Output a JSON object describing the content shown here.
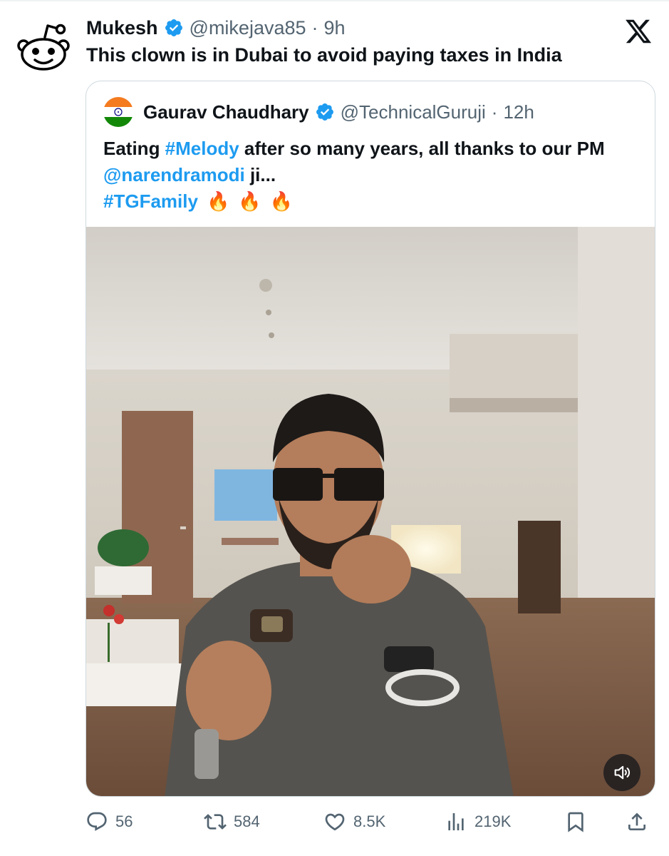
{
  "tweet": {
    "author_name": "Mukesh",
    "author_handle": "@mikejava85",
    "separator": "·",
    "time": "9h",
    "text": "This clown is in Dubai to avoid paying taxes in India",
    "avatar_icon": "reddit-snoo-icon",
    "platform_icon": "x-logo-icon"
  },
  "quoted": {
    "author_name": "Gaurav Chaudhary",
    "author_handle": "@TechnicalGuruji",
    "separator": "·",
    "time": "12h",
    "text_part1": "Eating ",
    "hashtag1": "#Melody",
    "text_part2": " after so many years, all thanks to our PM ",
    "mention": "@narendramodi",
    "text_part3": " ji...",
    "hashtag2": "#TGFamily",
    "emoji": [
      "🔥",
      "🔥",
      "🔥"
    ],
    "avatar_icon": "india-flag-icon"
  },
  "media": {
    "type": "video",
    "mute_icon": "speaker-muted-icon"
  },
  "actions": {
    "replies": "56",
    "reposts": "584",
    "likes": "8.5K",
    "views": "219K"
  },
  "colors": {
    "link": "#1d9bf0",
    "verified": "#1d9bf0",
    "secondary_text": "#536471",
    "border": "#cfd9de"
  }
}
